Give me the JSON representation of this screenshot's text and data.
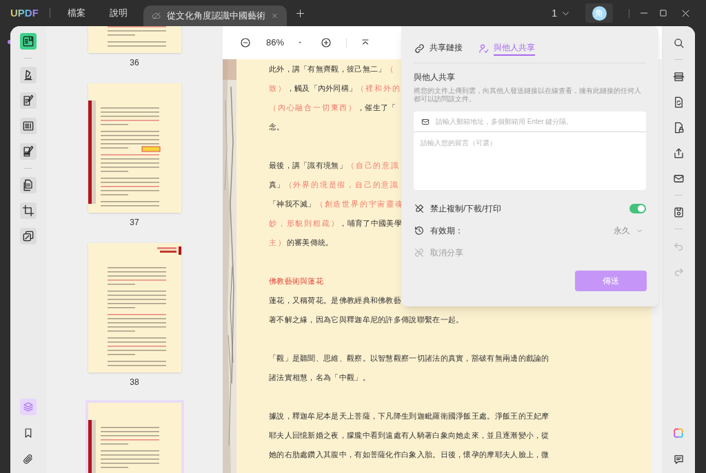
{
  "title_bar": {
    "logo": "UPDF",
    "menu": [
      "檔案",
      "說明"
    ],
    "document_tab": {
      "title": "從文化角度認識中國藝術"
    },
    "page_count": "1",
    "avatar": "角"
  },
  "left_toolbar": {
    "groups": [
      {
        "tools": [
          {
            "selected": true
          }
        ]
      },
      {
        "tools": [
          {
            "selected": false
          },
          {
            "selected": false
          },
          {
            "selected": false
          },
          {
            "selected": false
          }
        ]
      },
      {
        "tools": [
          {
            "selected": false
          },
          {
            "selected": false
          },
          {
            "selected": false
          }
        ]
      }
    ],
    "bottom": [
      {
        "selected": true
      },
      {
        "selected": false
      },
      {
        "selected": false
      }
    ]
  },
  "thumbnails": [
    {
      "label": "36",
      "selected": false
    },
    {
      "label": "37",
      "selected": false
    },
    {
      "label": "38",
      "selected": false
    },
    {
      "selected": true
    }
  ],
  "viewer_toolbar": {
    "zoom": "86%"
  },
  "page": {
    "paragraphs": [
      {
        "kind": "body",
        "lines": [
          [
            {
              "kind": "plain",
              "text": "此外，講「有無齊觀，彼己無二」"
            },
            {
              "kind": "note",
              "text": "（"
            }
          ],
          [
            {
              "kind": "note",
              "text": "致）"
            },
            {
              "kind": "plain",
              "text": "，觸及「內外同構」"
            },
            {
              "kind": "note",
              "text": "（裡和外的"
            }
          ],
          [
            {
              "kind": "note",
              "text": "（內心融合一切東西）"
            },
            {
              "kind": "plain",
              "text": "，催生了「"
            }
          ],
          [
            {
              "kind": "plain",
              "text": "念。"
            }
          ]
        ]
      },
      {
        "kind": "body",
        "lines": [
          [
            {
              "kind": "plain",
              "text": "最後，講「識有境無」"
            },
            {
              "kind": "note",
              "text": "（自己的意識"
            }
          ],
          [
            {
              "kind": "plain",
              "text": "真」"
            },
            {
              "kind": "note",
              "text": "（外界的境是假，自己的意識"
            }
          ],
          [
            {
              "kind": "plain",
              "text": "「神我不滅」"
            },
            {
              "kind": "note",
              "text": "（創造世界的宇宙靈魂"
            }
          ],
          [
            {
              "kind": "note",
              "text": "妙，形貌則粗疏）"
            },
            {
              "kind": "plain",
              "text": "，哺育了中國美學"
            }
          ],
          [
            {
              "kind": "note",
              "text": "主）"
            },
            {
              "kind": "plain",
              "text": "的審美傳統。"
            }
          ]
        ]
      },
      {
        "kind": "heading",
        "lines": [
          [
            {
              "kind": "plain",
              "text": "佛教藝術與蓮花"
            }
          ]
        ]
      },
      {
        "kind": "body",
        "lines": [
          [
            {
              "kind": "plain",
              "text": "蓮花，又稱荷花。是佛教經典和佛教藝"
            }
          ],
          [
            {
              "kind": "plain",
              "text": "著不解之緣，因為它與釋迦牟尼的許多傳說聯繫在一起。"
            }
          ]
        ]
      },
      {
        "kind": "body",
        "lines": [
          [
            {
              "kind": "plain",
              "text": "「觀」是聽聞、思維、觀察。以智慧觀察一切諸法的真實，豁破有無兩邊的戲論的"
            }
          ],
          [
            {
              "kind": "plain",
              "text": "諸法實相慧，名為「中觀」。"
            }
          ]
        ]
      },
      {
        "kind": "body",
        "lines": [
          [
            {
              "kind": "plain",
              "text": "據說，釋迦牟尼本是天上菩薩，下凡降生到迦毗羅衛國淨飯王處。淨飯王的王妃摩"
            }
          ],
          [
            {
              "kind": "plain",
              "text": "耶夫人回憶新婚之夜，朦朧中看到遠處有人騎著白象向她走來，並且逐漸變小，從"
            }
          ],
          [
            {
              "kind": "plain",
              "text": "她的右肋處鑽入其腹中，有如菩薩化作白象入胎。日後，懷孕的摩耶夫人臉上，微"
            }
          ]
        ]
      }
    ]
  },
  "share_panel": {
    "tabs": [
      {
        "label": "共享鏈接",
        "selected": false
      },
      {
        "label": "與他人共享",
        "selected": true
      }
    ],
    "heading": "與他人共享",
    "description": "將您的文件上傳到雲，向其他人發送鏈接以在線查看，擁有此鏈接的任何人都可以訪問該文件。",
    "email_placeholder": "請輸入郵箱地址，多個郵箱用 Enter 鍵分隔。",
    "message_placeholder": "請輸入您的留言（可選）",
    "options": [
      {
        "kind": "toggle",
        "label": "禁止複制/下載/打印",
        "on": true,
        "disabled": false
      },
      {
        "kind": "select",
        "label": "有效期：",
        "value": "永久",
        "disabled": false
      },
      {
        "kind": "action",
        "label": "取消分享",
        "disabled": true
      }
    ],
    "send_button": "傳送"
  },
  "right_toolbar": {
    "groups": [
      {
        "tools": [
          {
            "disabled": false
          }
        ]
      },
      {
        "tools": [
          {
            "disabled": false
          },
          {
            "disabled": false
          },
          {
            "disabled": false
          },
          {
            "disabled": false
          },
          {
            "disabled": false
          }
        ]
      },
      {
        "tools": [
          {
            "disabled": false
          }
        ]
      },
      {
        "tools": [
          {
            "disabled": true
          },
          {
            "disabled": true
          }
        ]
      }
    ],
    "bottom": [
      {
        "disabled": false
      },
      {
        "disabled": false
      }
    ]
  }
}
